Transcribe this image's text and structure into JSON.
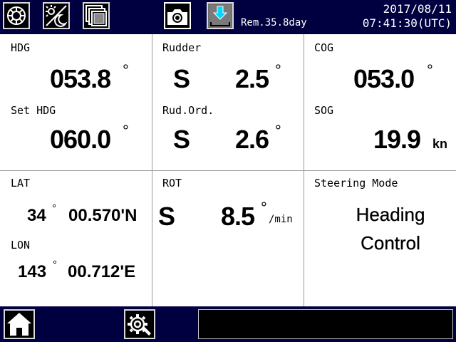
{
  "topbar": {
    "buttons": [
      {
        "name": "brightness-button",
        "icon": "sun-icon"
      },
      {
        "name": "day-night-button",
        "icon": "day-night-icon"
      },
      {
        "name": "window-switch-button",
        "icon": "stacked-windows-icon"
      },
      {
        "name": "camera-button",
        "icon": "camera-icon"
      },
      {
        "name": "download-button",
        "icon": "download-icon"
      }
    ],
    "remaining": "Rem.35.8day",
    "date": "2017/08/11",
    "time": "07:41:30(UTC)"
  },
  "panels": {
    "hdg": {
      "label": "HDG",
      "value": "053.8",
      "deg": "°"
    },
    "set_hdg": {
      "label": "Set HDG",
      "value": "060.0",
      "deg": "°"
    },
    "rudder": {
      "label": "Rudder",
      "side": "S",
      "value": "2.5",
      "deg": "°"
    },
    "rud_ord": {
      "label": "Rud.Ord.",
      "side": "S",
      "value": "2.6",
      "deg": "°"
    },
    "cog": {
      "label": "COG",
      "value": "053.0",
      "deg": "°"
    },
    "sog": {
      "label": "SOG",
      "value": "19.9",
      "unit": "kn"
    },
    "lat": {
      "label": "LAT",
      "deg_part": "34",
      "deg": "°",
      "min_part": "00.570'N"
    },
    "lon": {
      "label": "LON",
      "deg_part": "143",
      "deg": "°",
      "min_part": "00.712'E"
    },
    "rot": {
      "label": "ROT",
      "side": "S",
      "value": "8.5",
      "deg": "°",
      "unit": "/min"
    },
    "steering": {
      "label": "Steering Mode",
      "line1": "Heading",
      "line2": "Control"
    }
  },
  "bottombar": {
    "home_icon": "home-icon",
    "settings_icon": "settings-gear-icon",
    "message": ""
  }
}
